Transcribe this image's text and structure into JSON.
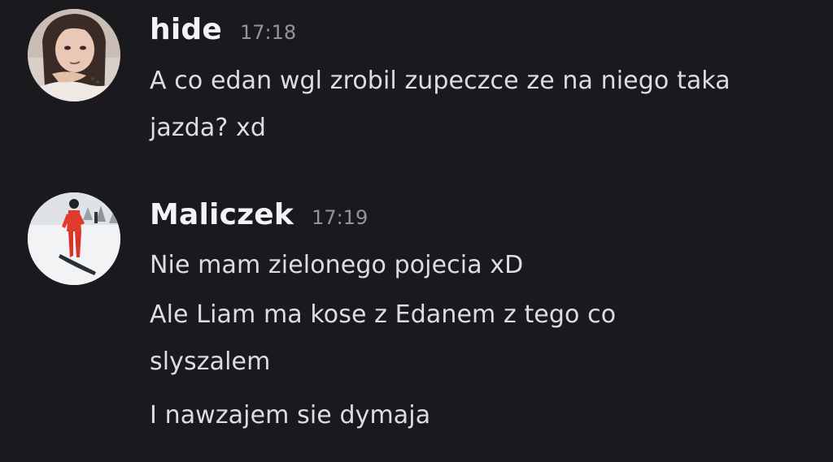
{
  "colors": {
    "background": "#1a1a1e",
    "username": "#f2f3f5",
    "timestamp": "#94959c",
    "message_text": "#dbdee1"
  },
  "messages": [
    {
      "username": "hide",
      "timestamp": "17:18",
      "avatar": "user-avatar-illustrated-character",
      "lines": [
        "A co edan wgl zrobil zupeczce ze na niego taka",
        "jazda? xd"
      ]
    },
    {
      "username": "Maliczek",
      "timestamp": "17:19",
      "avatar": "user-avatar-snowboarder-photo",
      "lines": [
        "Nie mam zielonego pojecia xD",
        "Ale Liam ma kose z Edanem z tego co",
        "slyszalem",
        "I nawzajem sie dymaja"
      ]
    }
  ]
}
